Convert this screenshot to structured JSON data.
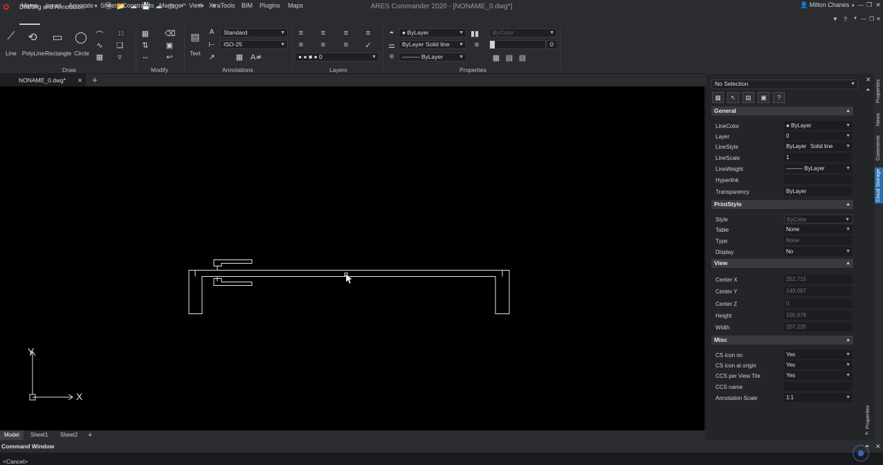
{
  "app": {
    "workspace": "Drafting and Annotation",
    "window_title": "ARES Commander 2020 - [NONAME_0.dwg*]",
    "user": "Milton Chanes"
  },
  "menu": [
    "Home",
    "Insert",
    "Annotate",
    "Sheet",
    "Constraints",
    "Manage",
    "View",
    "XtraTools",
    "BIM",
    "Plugins",
    "Maps"
  ],
  "ribbon": {
    "draw": {
      "label": "Draw",
      "line": "Line",
      "polyline": "PolyLine",
      "rectangle": "Rectangle",
      "circle": "Circle"
    },
    "modify": {
      "label": "Modify"
    },
    "annotations": {
      "label": "Annotations",
      "text": "Text",
      "text_style": "Standard",
      "dim_style": "ISO-25"
    },
    "layers": {
      "label": "Layers",
      "layer": "0"
    },
    "properties": {
      "label": "Properties",
      "color": "ByLayer",
      "linestyle_left": "ByLayer",
      "linestyle_right": "Solid line",
      "lineweight": "ByLayer",
      "print_style": "ByColor",
      "transparency": "0"
    }
  },
  "document_tab": "NONAME_0.dwg*",
  "sheets": [
    "Model",
    "Sheet1",
    "Sheet2"
  ],
  "command": {
    "title": "Command Window",
    "last": "<Cancel>"
  },
  "ucs": {
    "x": "X",
    "y": "Y"
  },
  "properties_panel": {
    "selection": "No Selection",
    "general": {
      "title": "General",
      "rows": [
        {
          "label": "LineColor",
          "value": "ByLayer"
        },
        {
          "label": "Layer",
          "value": "0"
        },
        {
          "label": "LineStyle",
          "value": "ByLayer",
          "value2": "Solid line"
        },
        {
          "label": "LineScale",
          "value": "1"
        },
        {
          "label": "LineWeight",
          "value": "ByLayer"
        },
        {
          "label": "Hyperlink",
          "value": ""
        },
        {
          "label": "Transparency",
          "value": "ByLayer"
        }
      ]
    },
    "printstyle": {
      "title": "PrintStyle",
      "rows": [
        {
          "label": "Style",
          "value": "ByColor"
        },
        {
          "label": "Table",
          "value": "None"
        },
        {
          "label": "Type",
          "value": "None"
        },
        {
          "label": "Display",
          "value": "No"
        }
      ]
    },
    "view": {
      "title": "View",
      "rows": [
        {
          "label": "Center X",
          "value": "252.715"
        },
        {
          "label": "Center Y",
          "value": "149.097"
        },
        {
          "label": "Center Z",
          "value": "0"
        },
        {
          "label": "Height",
          "value": "100.978"
        },
        {
          "label": "Width",
          "value": "207.235"
        }
      ]
    },
    "misc": {
      "title": "Misc",
      "rows": [
        {
          "label": "CS icon on",
          "value": "Yes"
        },
        {
          "label": "CS icon at origin",
          "value": "Yes"
        },
        {
          "label": "CCS per View Tile",
          "value": "Yes"
        },
        {
          "label": "CCS name",
          "value": ""
        },
        {
          "label": "Annotation Scale",
          "value": "1:1"
        }
      ]
    }
  },
  "side_tabs": [
    "Properties",
    "News",
    "Comments",
    "Cloud Storage"
  ],
  "panel_side_label": "Properties"
}
